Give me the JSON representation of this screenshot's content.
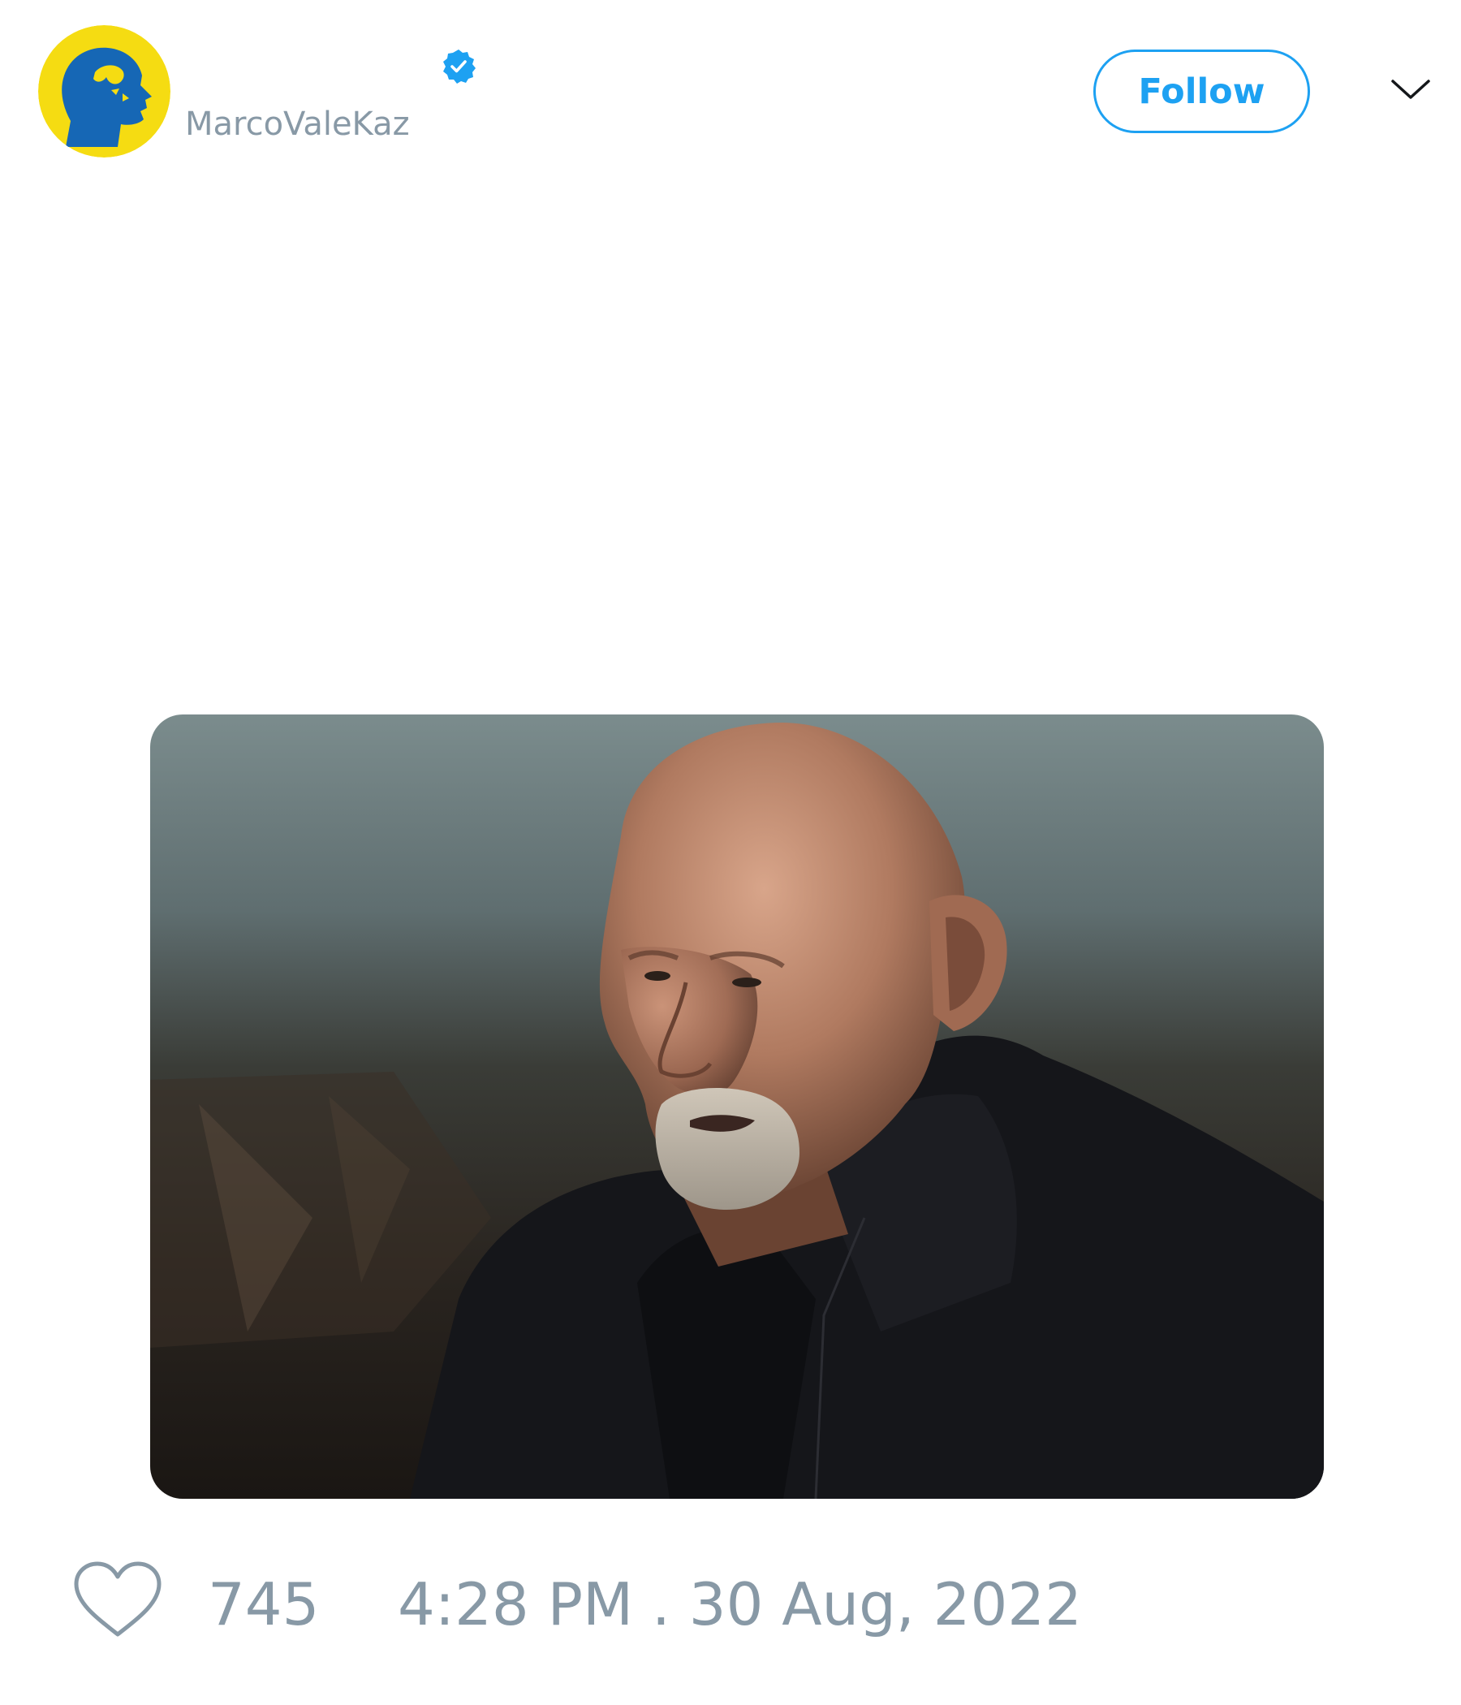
{
  "header": {
    "username": "MarcoValeKaz",
    "display_name": "",
    "follow_label": "Follow",
    "avatar_icon": "head-profile-logo-icon",
    "verified_icon": "verified-badge-icon",
    "more_icon": "chevron-down-icon"
  },
  "media": {
    "icon": "photo-elderly-bald-man-icon"
  },
  "footer": {
    "like_icon": "heart-outline-icon",
    "like_count": "745",
    "timestamp": "4:28 PM . 30 Aug, 2022"
  },
  "colors": {
    "accent": "#1da1f2",
    "muted_text": "#8899a6",
    "avatar_bg": "#f5dc12",
    "avatar_figure": "#1667b5"
  }
}
